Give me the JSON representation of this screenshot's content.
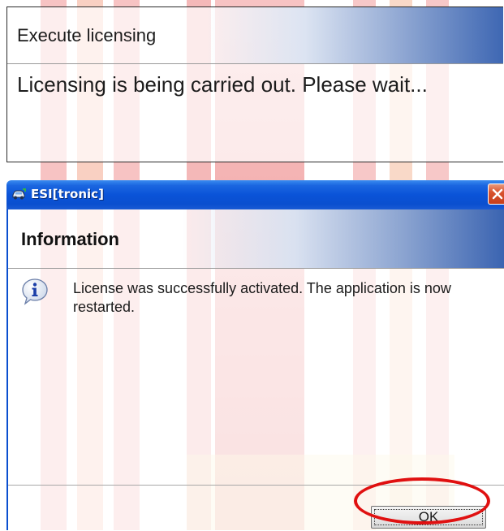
{
  "execute_panel": {
    "title": "Execute licensing",
    "message": "Licensing is being carried out. Please wait..."
  },
  "dialog": {
    "window_title": "ESI[tronic]",
    "app_icon": "car-icon",
    "close_icon": "close-icon",
    "heading": "Information",
    "info_icon": "info-icon",
    "message": "License was successfully activated. The application is now restarted.",
    "ok_label": "OK"
  },
  "annotation": {
    "highlight_color": "#e01010",
    "highlight_target": "ok-button"
  },
  "colors": {
    "titlebar": "#0a53d8",
    "close_button": "#d9532e",
    "watermark": "#e53b3b"
  }
}
